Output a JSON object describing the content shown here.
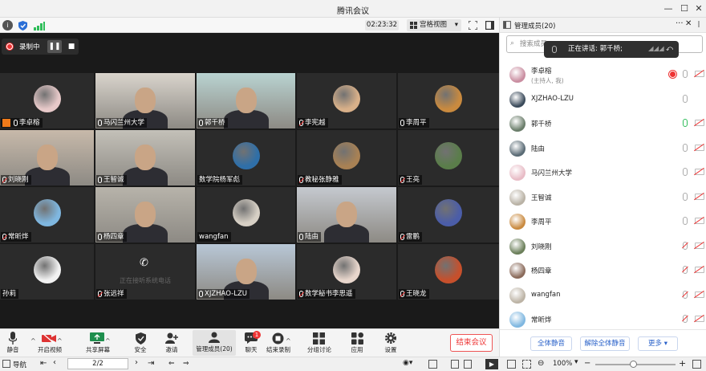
{
  "window": {
    "title": "腾讯会议"
  },
  "topbar": {
    "timer": "02:23:32",
    "view_label": "宫格视图"
  },
  "recording": {
    "label": "录制中"
  },
  "tiles": [
    {
      "name": "李卓榕",
      "mic": "mic",
      "kind": "avatar",
      "color": "#e7c9c9",
      "host_icon": true
    },
    {
      "name": "马闪兰州大学",
      "mic": "mic",
      "kind": "photo",
      "color": "#d9d4cc"
    },
    {
      "name": "郭千桥",
      "mic": "mic",
      "kind": "photo",
      "color": "#b9d3d1",
      "speaking": true
    },
    {
      "name": "李宪越",
      "mic": "muted",
      "kind": "avatar",
      "color": "#d8b089"
    },
    {
      "name": "李周平",
      "mic": "mic",
      "kind": "avatar",
      "color": "#c98a3f"
    },
    {
      "name": "刘晓刚",
      "mic": "muted",
      "kind": "photo",
      "color": "#c7b9aa"
    },
    {
      "name": "王智诚",
      "mic": "mic",
      "kind": "photo",
      "color": "#c3c0b8"
    },
    {
      "name": "数学院杨军彪",
      "mic": "none",
      "kind": "avatar",
      "color": "#2f6fa8"
    },
    {
      "name": "教秘张静雅",
      "mic": "muted",
      "kind": "avatar",
      "color": "#a88154"
    },
    {
      "name": "王亮",
      "mic": "muted",
      "kind": "avatar",
      "color": "#5a7d4a"
    },
    {
      "name": "常昕烨",
      "mic": "muted",
      "kind": "avatar",
      "color": "#7fb7e0"
    },
    {
      "name": "杨四章",
      "mic": "mic",
      "kind": "photo",
      "color": "#b7b3aa"
    },
    {
      "name": "wangfan",
      "mic": "none",
      "kind": "avatar",
      "color": "#d7d0c5"
    },
    {
      "name": "陆由",
      "mic": "mic",
      "kind": "photo",
      "color": "#c5c9cf"
    },
    {
      "name": "雷鹏",
      "mic": "muted",
      "kind": "avatar",
      "color": "#4b5da8"
    },
    {
      "name": "孙莉",
      "mic": "none",
      "kind": "avatar",
      "color": "#f2f2f2"
    },
    {
      "name": "张远祥",
      "mic": "muted",
      "kind": "phone",
      "color": "#3a3a3a",
      "phone_text": "正在接听系统电话"
    },
    {
      "name": "XJZHAO-LZU",
      "mic": "mic",
      "kind": "photo",
      "color": "#b8c7d6"
    },
    {
      "name": "数学秘书李思遥",
      "mic": "muted",
      "kind": "avatar",
      "color": "#e8d6cc"
    },
    {
      "name": "王晓龙",
      "mic": "muted",
      "kind": "avatar",
      "color": "#c6502c"
    }
  ],
  "controls": [
    {
      "label": "静音",
      "icon": "microphone-icon",
      "caret": true
    },
    {
      "label": "开启视频",
      "icon": "video-off-icon",
      "caret": true
    },
    {
      "label": "共享屏幕",
      "icon": "screen-share-icon",
      "caret": true
    },
    {
      "label": "安全",
      "icon": "shield-icon"
    },
    {
      "label": "邀请",
      "icon": "invite-icon"
    },
    {
      "label": "管理成员(20)",
      "icon": "members-icon"
    },
    {
      "label": "聊天",
      "icon": "chat-icon",
      "badge": "1"
    },
    {
      "label": "结束录制",
      "icon": "stop-record-icon",
      "caret": true
    },
    {
      "label": "分组讨论",
      "icon": "breakout-icon"
    },
    {
      "label": "应用",
      "icon": "apps-icon"
    },
    {
      "label": "设置",
      "icon": "gear-icon"
    }
  ],
  "end_meeting": "结束会议",
  "status": {
    "nav_label": "导航",
    "page": "2/2",
    "zoom": "100%"
  },
  "panel": {
    "title": "管理成员(20)",
    "search_placeholder": "搜索成员",
    "toast": "正在讲话: 郭千桥;",
    "members": [
      {
        "name": "李卓榕",
        "sub": "(主持人, 我)",
        "color": "#c98da0",
        "mic": "normal",
        "cam": "off",
        "rec": true
      },
      {
        "name": "XJZHAO-LZU",
        "color": "#3a4a5a",
        "mic": "normal",
        "cam": "none"
      },
      {
        "name": "郭千桥",
        "color": "#6a7d6a",
        "mic": "on",
        "cam": "off"
      },
      {
        "name": "陆由",
        "color": "#5a6b75",
        "mic": "normal",
        "cam": "off"
      },
      {
        "name": "马闪兰州大学",
        "color": "#e8bcc6",
        "mic": "normal",
        "cam": "off"
      },
      {
        "name": "王智诚",
        "color": "#b9b2a5",
        "mic": "normal",
        "cam": "off"
      },
      {
        "name": "李周平",
        "color": "#c98a3f",
        "mic": "normal",
        "cam": "off"
      },
      {
        "name": "刘晓刚",
        "color": "#6b7f5a",
        "mic": "off",
        "cam": "off"
      },
      {
        "name": "杨四章",
        "color": "#8a6a5a",
        "mic": "off",
        "cam": "off"
      },
      {
        "name": "wangfan",
        "color": "#bcb3a5",
        "mic": "off",
        "cam": "off"
      },
      {
        "name": "常昕烨",
        "color": "#7fb7e0",
        "mic": "off",
        "cam": "off"
      }
    ],
    "btn_mute_all": "全体静音",
    "btn_unmute_all": "解除全体静音",
    "btn_more": "更多"
  }
}
